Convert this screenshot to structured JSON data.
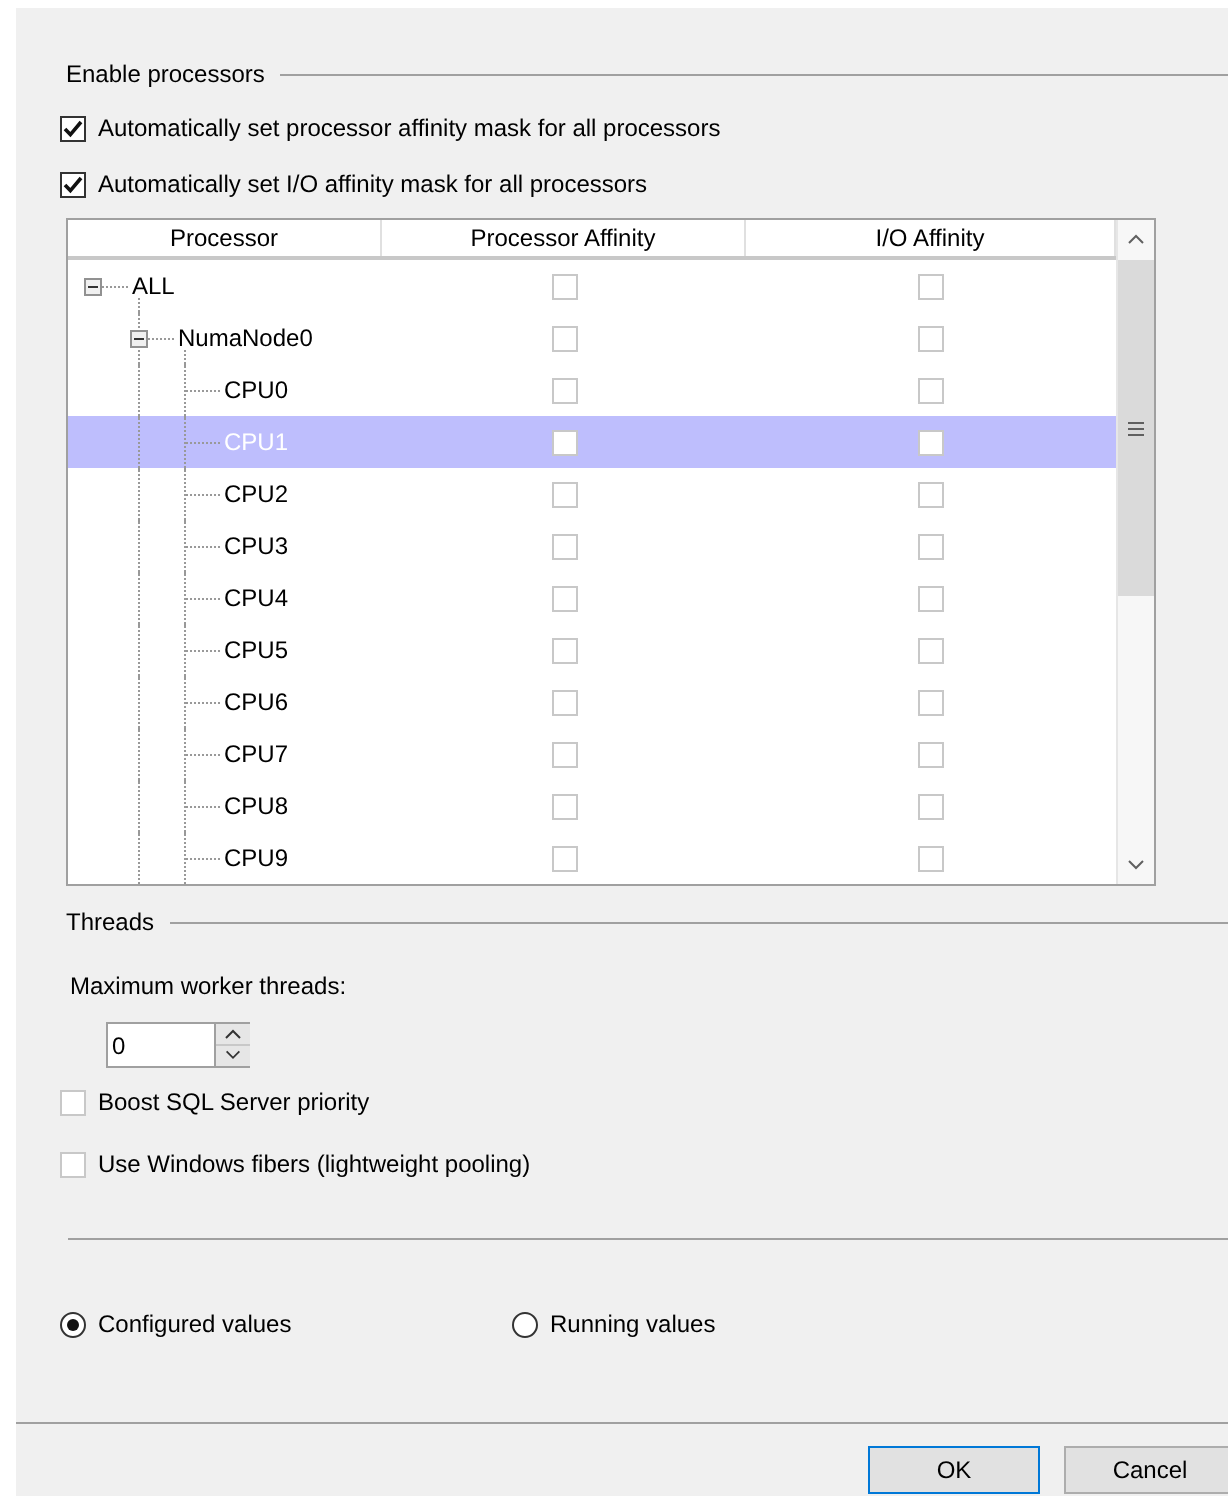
{
  "enable_processors": {
    "title": "Enable processors",
    "options": [
      {
        "label": "Automatically set processor affinity mask for all processors",
        "checked": true
      },
      {
        "label": "Automatically set I/O affinity mask for all processors",
        "checked": true
      }
    ],
    "grid": {
      "columns": [
        "Processor",
        "Processor Affinity",
        "I/O Affinity"
      ],
      "rows": [
        {
          "name": "ALL",
          "expanded": true,
          "selected": false,
          "processor_affinity": false,
          "io_affinity": false,
          "children": [
            {
              "name": "NumaNode0",
              "expanded": true,
              "selected": false,
              "processor_affinity": false,
              "io_affinity": false,
              "children": [
                {
                  "name": "CPU0",
                  "selected": false,
                  "processor_affinity": false,
                  "io_affinity": false
                },
                {
                  "name": "CPU1",
                  "selected": true,
                  "processor_affinity": false,
                  "io_affinity": false
                },
                {
                  "name": "CPU2",
                  "selected": false,
                  "processor_affinity": false,
                  "io_affinity": false
                },
                {
                  "name": "CPU3",
                  "selected": false,
                  "processor_affinity": false,
                  "io_affinity": false
                },
                {
                  "name": "CPU4",
                  "selected": false,
                  "processor_affinity": false,
                  "io_affinity": false
                },
                {
                  "name": "CPU5",
                  "selected": false,
                  "processor_affinity": false,
                  "io_affinity": false
                },
                {
                  "name": "CPU6",
                  "selected": false,
                  "processor_affinity": false,
                  "io_affinity": false
                },
                {
                  "name": "CPU7",
                  "selected": false,
                  "processor_affinity": false,
                  "io_affinity": false
                },
                {
                  "name": "CPU8",
                  "selected": false,
                  "processor_affinity": false,
                  "io_affinity": false
                },
                {
                  "name": "CPU9",
                  "selected": false,
                  "processor_affinity": false,
                  "io_affinity": false
                }
              ]
            }
          ]
        }
      ]
    }
  },
  "threads": {
    "title": "Threads",
    "max_worker_label": "Maximum worker threads:",
    "max_worker_value": "0",
    "options": [
      {
        "label": "Boost SQL Server priority",
        "checked": false
      },
      {
        "label": "Use Windows fibers (lightweight pooling)",
        "checked": false
      }
    ]
  },
  "values_mode": [
    {
      "label": "Configured  values",
      "selected": true
    },
    {
      "label": "Running values",
      "selected": false
    }
  ],
  "buttons": [
    "OK",
    "Cancel"
  ]
}
